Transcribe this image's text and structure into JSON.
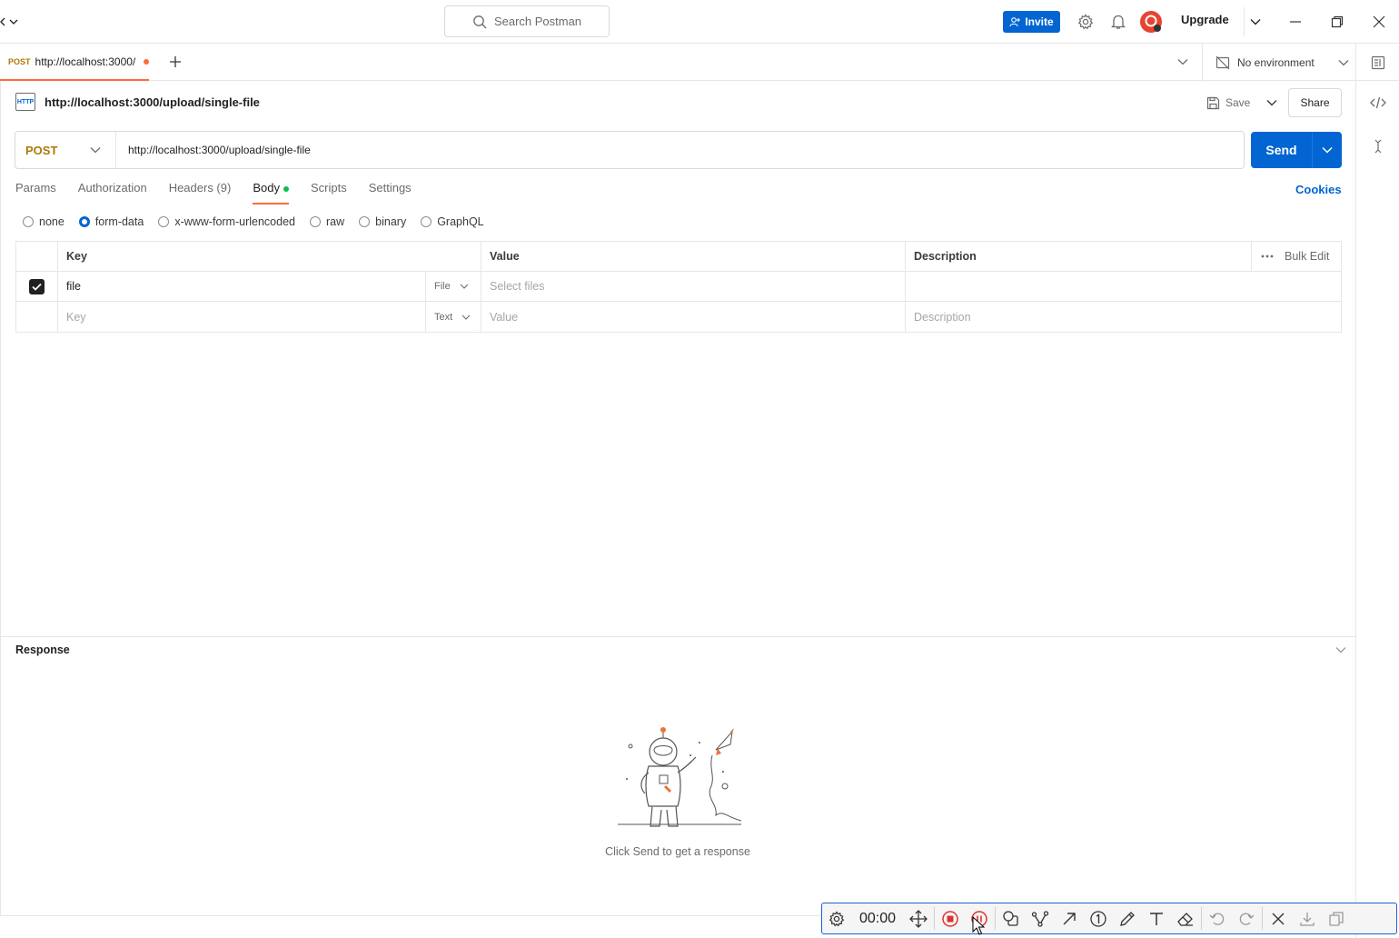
{
  "topbar": {
    "search_placeholder": "Search Postman",
    "invite_label": "Invite",
    "upgrade_label": "Upgrade"
  },
  "tabs": {
    "active_tab": {
      "method": "POST",
      "url": "http://localhost:3000/upload/single-file"
    },
    "environment": "No environment"
  },
  "request": {
    "title": "http://localhost:3000/upload/single-file",
    "save_label": "Save",
    "share_label": "Share",
    "method": "POST",
    "url": "http://localhost:3000/upload/single-file",
    "send_label": "Send",
    "tabs": [
      "Params",
      "Authorization",
      "Headers (9)",
      "Body",
      "Scripts",
      "Settings"
    ],
    "active_tab": "Body",
    "cookies_label": "Cookies",
    "body_types": [
      "none",
      "form-data",
      "x-www-form-urlencoded",
      "raw",
      "binary",
      "GraphQL"
    ],
    "selected_body_type": "form-data"
  },
  "form_table": {
    "headers": [
      "Key",
      "Value",
      "Description"
    ],
    "bulk_edit_label": "Bulk Edit",
    "rows": [
      {
        "checked": true,
        "key": "file",
        "type": "File",
        "value_placeholder": "Select files",
        "description": ""
      },
      {
        "checked": false,
        "key_placeholder": "Key",
        "type": "Text",
        "value_placeholder": "Value",
        "description_placeholder": "Description"
      }
    ]
  },
  "response": {
    "title": "Response",
    "empty_message": "Click Send to get a response"
  },
  "recorder": {
    "timer": "00:00"
  },
  "colors": {
    "accent_orange": "#ff6c37",
    "primary_blue": "#0265d2",
    "method_post": "#ad7a03",
    "body_dot_green": "#0cbb52"
  }
}
